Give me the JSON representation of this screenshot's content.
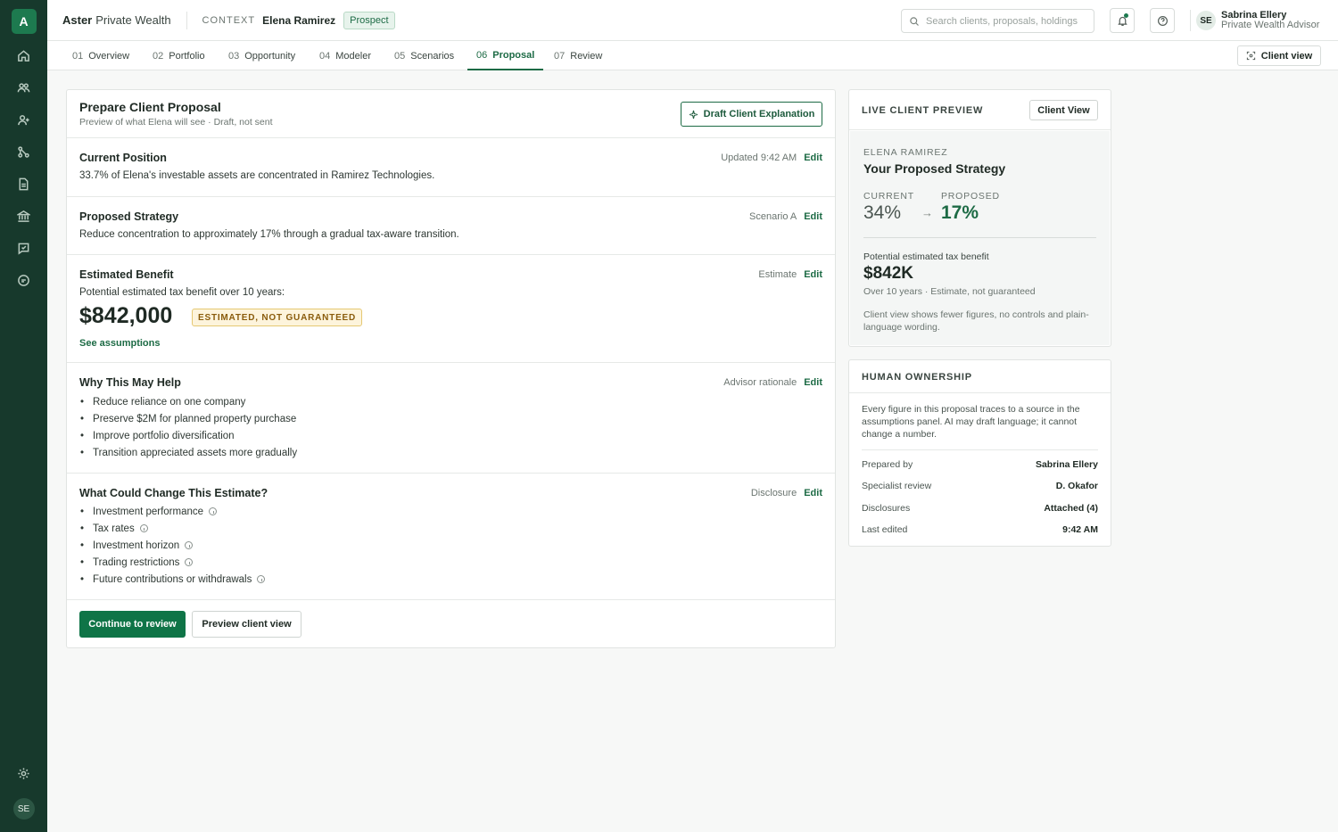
{
  "sidebar": {
    "logo": "A",
    "nav": [
      "home-icon",
      "clients-icon",
      "add-user-icon",
      "scenarios-icon",
      "document-icon",
      "bank-icon",
      "review-icon",
      "chat-icon"
    ],
    "settings": "gear-icon",
    "avatar": "SE"
  },
  "header": {
    "brand_bold": "Aster",
    "brand_rest": "Private Wealth",
    "context_label": "CONTEXT",
    "context_name": "Elena Ramirez",
    "context_badge": "Prospect",
    "search_placeholder": "Search clients, proposals, holdings",
    "user_initials": "SE",
    "user_name": "Sabrina Ellery",
    "user_role": "Private Wealth Advisor"
  },
  "tabs": [
    {
      "num": "01",
      "label": "Overview"
    },
    {
      "num": "02",
      "label": "Portfolio"
    },
    {
      "num": "03",
      "label": "Opportunity"
    },
    {
      "num": "04",
      "label": "Modeler"
    },
    {
      "num": "05",
      "label": "Scenarios"
    },
    {
      "num": "06",
      "label": "Proposal"
    },
    {
      "num": "07",
      "label": "Review"
    }
  ],
  "active_tab": "Proposal",
  "client_view_label": "Client view",
  "proposal": {
    "title": "Prepare Client Proposal",
    "subtitle": "Preview of what Elena will see · Draft, not sent",
    "draft_button": "Draft Client Explanation",
    "edit_label": "Edit",
    "current": {
      "title": "Current Position",
      "meta": "Updated 9:42 AM",
      "text": "33.7% of Elena's investable assets are concentrated in Ramirez Technologies."
    },
    "strategy": {
      "title": "Proposed Strategy",
      "meta": "Scenario A",
      "text": "Reduce concentration to approximately 17% through a gradual tax-aware transition."
    },
    "benefit": {
      "title": "Estimated Benefit",
      "meta": "Estimate",
      "text": "Potential estimated tax benefit over 10 years:",
      "value": "$842,000",
      "badge": "ESTIMATED, NOT GUARANTEED",
      "link": "See assumptions"
    },
    "why": {
      "title": "Why This May Help",
      "meta": "Advisor rationale",
      "items": [
        "Reduce reliance on one company",
        "Preserve $2M for planned property purchase",
        "Improve portfolio diversification",
        "Transition appreciated assets more gradually"
      ]
    },
    "change": {
      "title": "What Could Change This Estimate?",
      "meta": "Disclosure",
      "items": [
        "Investment performance",
        "Tax rates",
        "Investment horizon",
        "Trading restrictions",
        "Future contributions or withdrawals"
      ]
    },
    "continue_button": "Continue to review",
    "preview_button": "Preview client view"
  },
  "preview": {
    "title": "LIVE CLIENT PREVIEW",
    "button": "Client View",
    "client": "ELENA RAMIREZ",
    "heading": "Your Proposed Strategy",
    "current_label": "CURRENT",
    "current_value": "34%",
    "proposed_label": "PROPOSED",
    "proposed_value": "17%",
    "benefit_label": "Potential estimated tax benefit",
    "benefit_value": "$842K",
    "benefit_sub": "Over 10 years · Estimate, not guaranteed",
    "note": "Client view shows fewer figures, no controls and plain-language wording."
  },
  "ownership": {
    "title": "HUMAN OWNERSHIP",
    "text": "Every figure in this proposal traces to a source in the assumptions panel. AI may draft language; it cannot change a number.",
    "rows": [
      {
        "k": "Prepared by",
        "v": "Sabrina Ellery"
      },
      {
        "k": "Specialist review",
        "v": "D. Okafor"
      },
      {
        "k": "Disclosures",
        "v": "Attached (4)"
      },
      {
        "k": "Last edited",
        "v": "9:42 AM"
      }
    ]
  }
}
